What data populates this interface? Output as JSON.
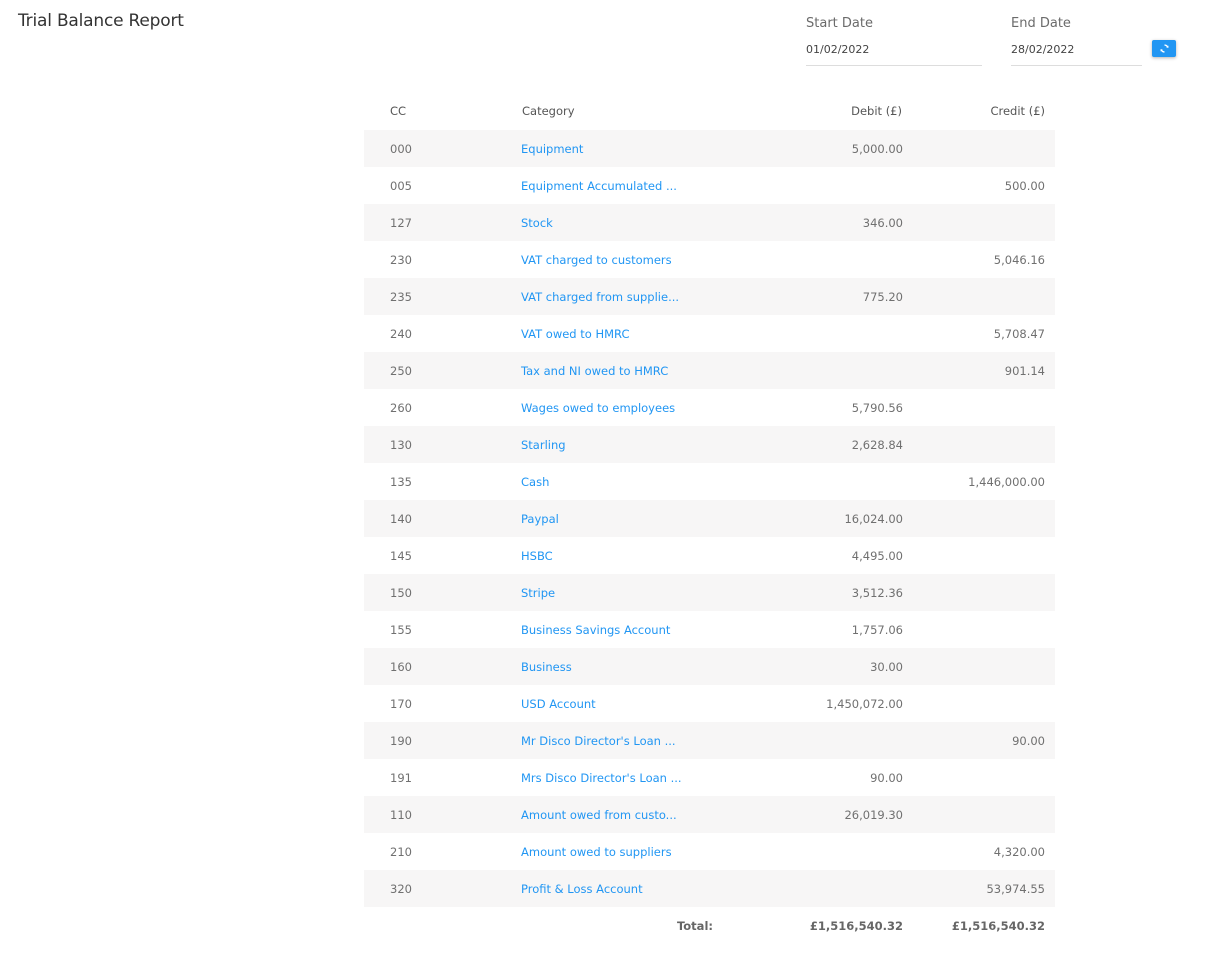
{
  "page": {
    "title": "Trial Balance Report"
  },
  "filters": {
    "start_date": {
      "label": "Start Date",
      "value": "01/02/2022"
    },
    "end_date": {
      "label": "End Date",
      "value": "28/02/2022"
    },
    "refresh_icon": "refresh-icon",
    "accent_color": "#2196f3"
  },
  "table": {
    "headers": {
      "cc": "CC",
      "category": "Category",
      "debit": "Debit (£)",
      "credit": "Credit (£)"
    },
    "rows": [
      {
        "cc": "000",
        "category": "Equipment",
        "debit": "5,000.00",
        "credit": ""
      },
      {
        "cc": "005",
        "category": "Equipment Accumulated ...",
        "debit": "",
        "credit": "500.00"
      },
      {
        "cc": "127",
        "category": "Stock",
        "debit": "346.00",
        "credit": ""
      },
      {
        "cc": "230",
        "category": "VAT charged to customers",
        "debit": "",
        "credit": "5,046.16"
      },
      {
        "cc": "235",
        "category": "VAT charged from supplie...",
        "debit": "775.20",
        "credit": ""
      },
      {
        "cc": "240",
        "category": "VAT owed to HMRC",
        "debit": "",
        "credit": "5,708.47"
      },
      {
        "cc": "250",
        "category": "Tax and NI owed to HMRC",
        "debit": "",
        "credit": "901.14"
      },
      {
        "cc": "260",
        "category": "Wages owed to employees",
        "debit": "5,790.56",
        "credit": ""
      },
      {
        "cc": "130",
        "category": "Starling",
        "debit": "2,628.84",
        "credit": ""
      },
      {
        "cc": "135",
        "category": "Cash",
        "debit": "",
        "credit": "1,446,000.00"
      },
      {
        "cc": "140",
        "category": "Paypal",
        "debit": "16,024.00",
        "credit": ""
      },
      {
        "cc": "145",
        "category": "HSBC",
        "debit": "4,495.00",
        "credit": ""
      },
      {
        "cc": "150",
        "category": "Stripe",
        "debit": "3,512.36",
        "credit": ""
      },
      {
        "cc": "155",
        "category": "Business Savings Account",
        "debit": "1,757.06",
        "credit": ""
      },
      {
        "cc": "160",
        "category": "Business",
        "debit": "30.00",
        "credit": ""
      },
      {
        "cc": "170",
        "category": "USD Account",
        "debit": "1,450,072.00",
        "credit": ""
      },
      {
        "cc": "190",
        "category": "Mr Disco Director's Loan ...",
        "debit": "",
        "credit": "90.00"
      },
      {
        "cc": "191",
        "category": "Mrs Disco Director's Loan ...",
        "debit": "90.00",
        "credit": ""
      },
      {
        "cc": "110",
        "category": "Amount owed from custo...",
        "debit": "26,019.30",
        "credit": ""
      },
      {
        "cc": "210",
        "category": "Amount owed to suppliers",
        "debit": "",
        "credit": "4,320.00"
      },
      {
        "cc": "320",
        "category": "Profit & Loss Account",
        "debit": "",
        "credit": "53,974.55"
      }
    ],
    "footer": {
      "label": "Total:",
      "debit_total": "£1,516,540.32",
      "credit_total": "£1,516,540.32"
    }
  }
}
